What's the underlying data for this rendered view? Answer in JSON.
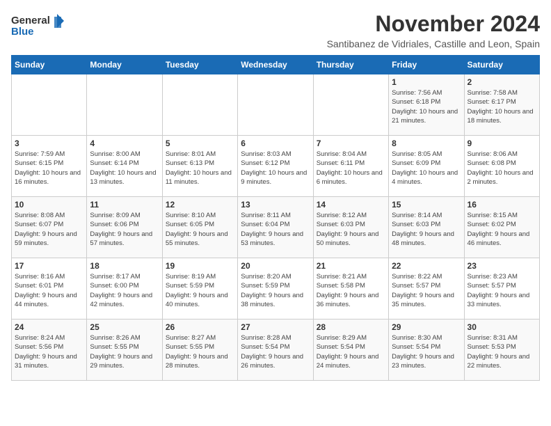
{
  "header": {
    "logo_line1": "General",
    "logo_line2": "Blue",
    "month_title": "November 2024",
    "subtitle": "Santibanez de Vidriales, Castille and Leon, Spain"
  },
  "weekdays": [
    "Sunday",
    "Monday",
    "Tuesday",
    "Wednesday",
    "Thursday",
    "Friday",
    "Saturday"
  ],
  "weeks": [
    [
      {
        "day": "",
        "info": ""
      },
      {
        "day": "",
        "info": ""
      },
      {
        "day": "",
        "info": ""
      },
      {
        "day": "",
        "info": ""
      },
      {
        "day": "",
        "info": ""
      },
      {
        "day": "1",
        "info": "Sunrise: 7:56 AM\nSunset: 6:18 PM\nDaylight: 10 hours and 21 minutes."
      },
      {
        "day": "2",
        "info": "Sunrise: 7:58 AM\nSunset: 6:17 PM\nDaylight: 10 hours and 18 minutes."
      }
    ],
    [
      {
        "day": "3",
        "info": "Sunrise: 7:59 AM\nSunset: 6:15 PM\nDaylight: 10 hours and 16 minutes."
      },
      {
        "day": "4",
        "info": "Sunrise: 8:00 AM\nSunset: 6:14 PM\nDaylight: 10 hours and 13 minutes."
      },
      {
        "day": "5",
        "info": "Sunrise: 8:01 AM\nSunset: 6:13 PM\nDaylight: 10 hours and 11 minutes."
      },
      {
        "day": "6",
        "info": "Sunrise: 8:03 AM\nSunset: 6:12 PM\nDaylight: 10 hours and 9 minutes."
      },
      {
        "day": "7",
        "info": "Sunrise: 8:04 AM\nSunset: 6:11 PM\nDaylight: 10 hours and 6 minutes."
      },
      {
        "day": "8",
        "info": "Sunrise: 8:05 AM\nSunset: 6:09 PM\nDaylight: 10 hours and 4 minutes."
      },
      {
        "day": "9",
        "info": "Sunrise: 8:06 AM\nSunset: 6:08 PM\nDaylight: 10 hours and 2 minutes."
      }
    ],
    [
      {
        "day": "10",
        "info": "Sunrise: 8:08 AM\nSunset: 6:07 PM\nDaylight: 9 hours and 59 minutes."
      },
      {
        "day": "11",
        "info": "Sunrise: 8:09 AM\nSunset: 6:06 PM\nDaylight: 9 hours and 57 minutes."
      },
      {
        "day": "12",
        "info": "Sunrise: 8:10 AM\nSunset: 6:05 PM\nDaylight: 9 hours and 55 minutes."
      },
      {
        "day": "13",
        "info": "Sunrise: 8:11 AM\nSunset: 6:04 PM\nDaylight: 9 hours and 53 minutes."
      },
      {
        "day": "14",
        "info": "Sunrise: 8:12 AM\nSunset: 6:03 PM\nDaylight: 9 hours and 50 minutes."
      },
      {
        "day": "15",
        "info": "Sunrise: 8:14 AM\nSunset: 6:03 PM\nDaylight: 9 hours and 48 minutes."
      },
      {
        "day": "16",
        "info": "Sunrise: 8:15 AM\nSunset: 6:02 PM\nDaylight: 9 hours and 46 minutes."
      }
    ],
    [
      {
        "day": "17",
        "info": "Sunrise: 8:16 AM\nSunset: 6:01 PM\nDaylight: 9 hours and 44 minutes."
      },
      {
        "day": "18",
        "info": "Sunrise: 8:17 AM\nSunset: 6:00 PM\nDaylight: 9 hours and 42 minutes."
      },
      {
        "day": "19",
        "info": "Sunrise: 8:19 AM\nSunset: 5:59 PM\nDaylight: 9 hours and 40 minutes."
      },
      {
        "day": "20",
        "info": "Sunrise: 8:20 AM\nSunset: 5:59 PM\nDaylight: 9 hours and 38 minutes."
      },
      {
        "day": "21",
        "info": "Sunrise: 8:21 AM\nSunset: 5:58 PM\nDaylight: 9 hours and 36 minutes."
      },
      {
        "day": "22",
        "info": "Sunrise: 8:22 AM\nSunset: 5:57 PM\nDaylight: 9 hours and 35 minutes."
      },
      {
        "day": "23",
        "info": "Sunrise: 8:23 AM\nSunset: 5:57 PM\nDaylight: 9 hours and 33 minutes."
      }
    ],
    [
      {
        "day": "24",
        "info": "Sunrise: 8:24 AM\nSunset: 5:56 PM\nDaylight: 9 hours and 31 minutes."
      },
      {
        "day": "25",
        "info": "Sunrise: 8:26 AM\nSunset: 5:55 PM\nDaylight: 9 hours and 29 minutes."
      },
      {
        "day": "26",
        "info": "Sunrise: 8:27 AM\nSunset: 5:55 PM\nDaylight: 9 hours and 28 minutes."
      },
      {
        "day": "27",
        "info": "Sunrise: 8:28 AM\nSunset: 5:54 PM\nDaylight: 9 hours and 26 minutes."
      },
      {
        "day": "28",
        "info": "Sunrise: 8:29 AM\nSunset: 5:54 PM\nDaylight: 9 hours and 24 minutes."
      },
      {
        "day": "29",
        "info": "Sunrise: 8:30 AM\nSunset: 5:54 PM\nDaylight: 9 hours and 23 minutes."
      },
      {
        "day": "30",
        "info": "Sunrise: 8:31 AM\nSunset: 5:53 PM\nDaylight: 9 hours and 22 minutes."
      }
    ]
  ]
}
